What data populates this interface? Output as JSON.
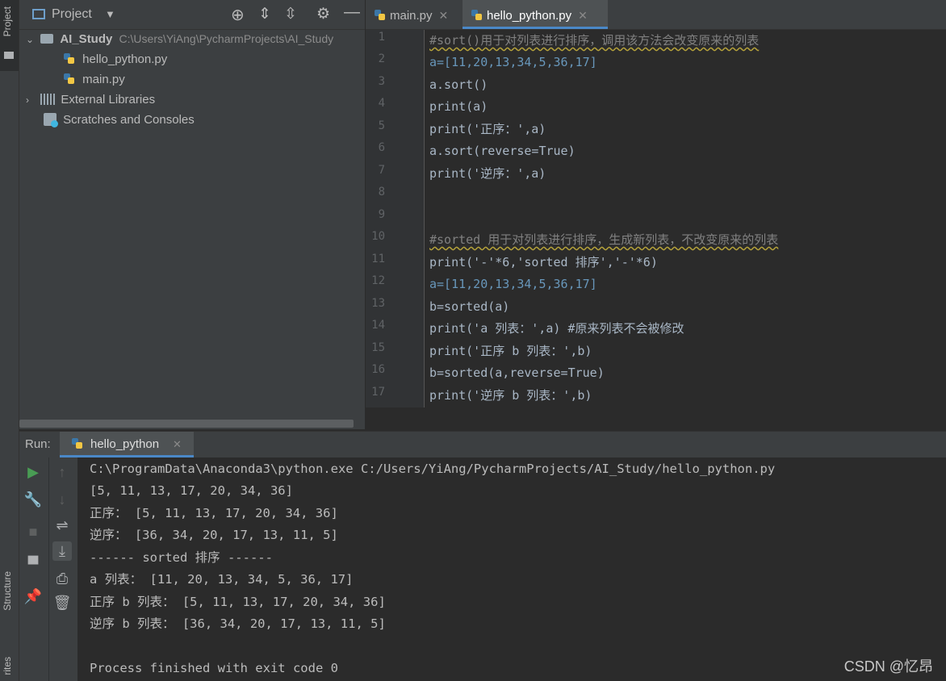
{
  "left_stripe": {
    "project_label": "Project",
    "structure_label": "Structure",
    "favorites_label": "rites"
  },
  "project_panel": {
    "title": "Project",
    "tree": [
      {
        "label": "AI_Study",
        "path": "C:\\Users\\YiAng\\PycharmProjects\\AI_Study"
      },
      {
        "label": "hello_python.py"
      },
      {
        "label": "main.py"
      },
      {
        "label": "External Libraries"
      },
      {
        "label": "Scratches and Consoles"
      }
    ]
  },
  "editor": {
    "tabs": [
      {
        "label": "main.py"
      },
      {
        "label": "hello_python.py"
      }
    ],
    "line_numbers": [
      "1",
      "2",
      "3",
      "4",
      "5",
      "6",
      "7",
      "8",
      "9",
      "10",
      "11",
      "12",
      "13",
      "14",
      "15",
      "16",
      "17"
    ],
    "lines": [
      "#sort()用于对列表进行排序，调用该方法会改变原来的列表",
      "a=[11,20,13,34,5,36,17]",
      "a.sort()",
      "print(a)",
      "print('正序：',a)",
      "a.sort(reverse=True)",
      "print('逆序：',a)",
      "",
      "",
      "#sorted 用于对列表进行排序，生成新列表，不改变原来的列表",
      "print('-'*6,'sorted 排序','-'*6)",
      "a=[11,20,13,34,5,36,17]",
      "b=sorted(a)",
      "print('a 列表：',a) #原来列表不会被修改",
      "print('正序 b 列表：',b)",
      "b=sorted(a,reverse=True)",
      "print('逆序 b 列表：',b)"
    ]
  },
  "run": {
    "label": "Run:",
    "tab_label": "hello_python",
    "output": [
      "C:\\ProgramData\\Anaconda3\\python.exe C:/Users/YiAng/PycharmProjects/AI_Study/hello_python.py",
      "[5, 11, 13, 17, 20, 34, 36]",
      "正序： [5, 11, 13, 17, 20, 34, 36]",
      "逆序： [36, 34, 20, 17, 13, 11, 5]",
      "------ sorted 排序 ------",
      "a 列表： [11, 20, 13, 34, 5, 36, 17]",
      "正序 b 列表： [5, 11, 13, 17, 20, 34, 36]",
      "逆序 b 列表： [36, 34, 20, 17, 13, 11, 5]",
      "",
      "Process finished with exit code 0"
    ]
  },
  "watermark": "CSDN @忆昂",
  "colors": {
    "accent": "#4a88c7",
    "run_green": "#499c54",
    "background": "#2b2b2b",
    "panel": "#3c3f41"
  }
}
